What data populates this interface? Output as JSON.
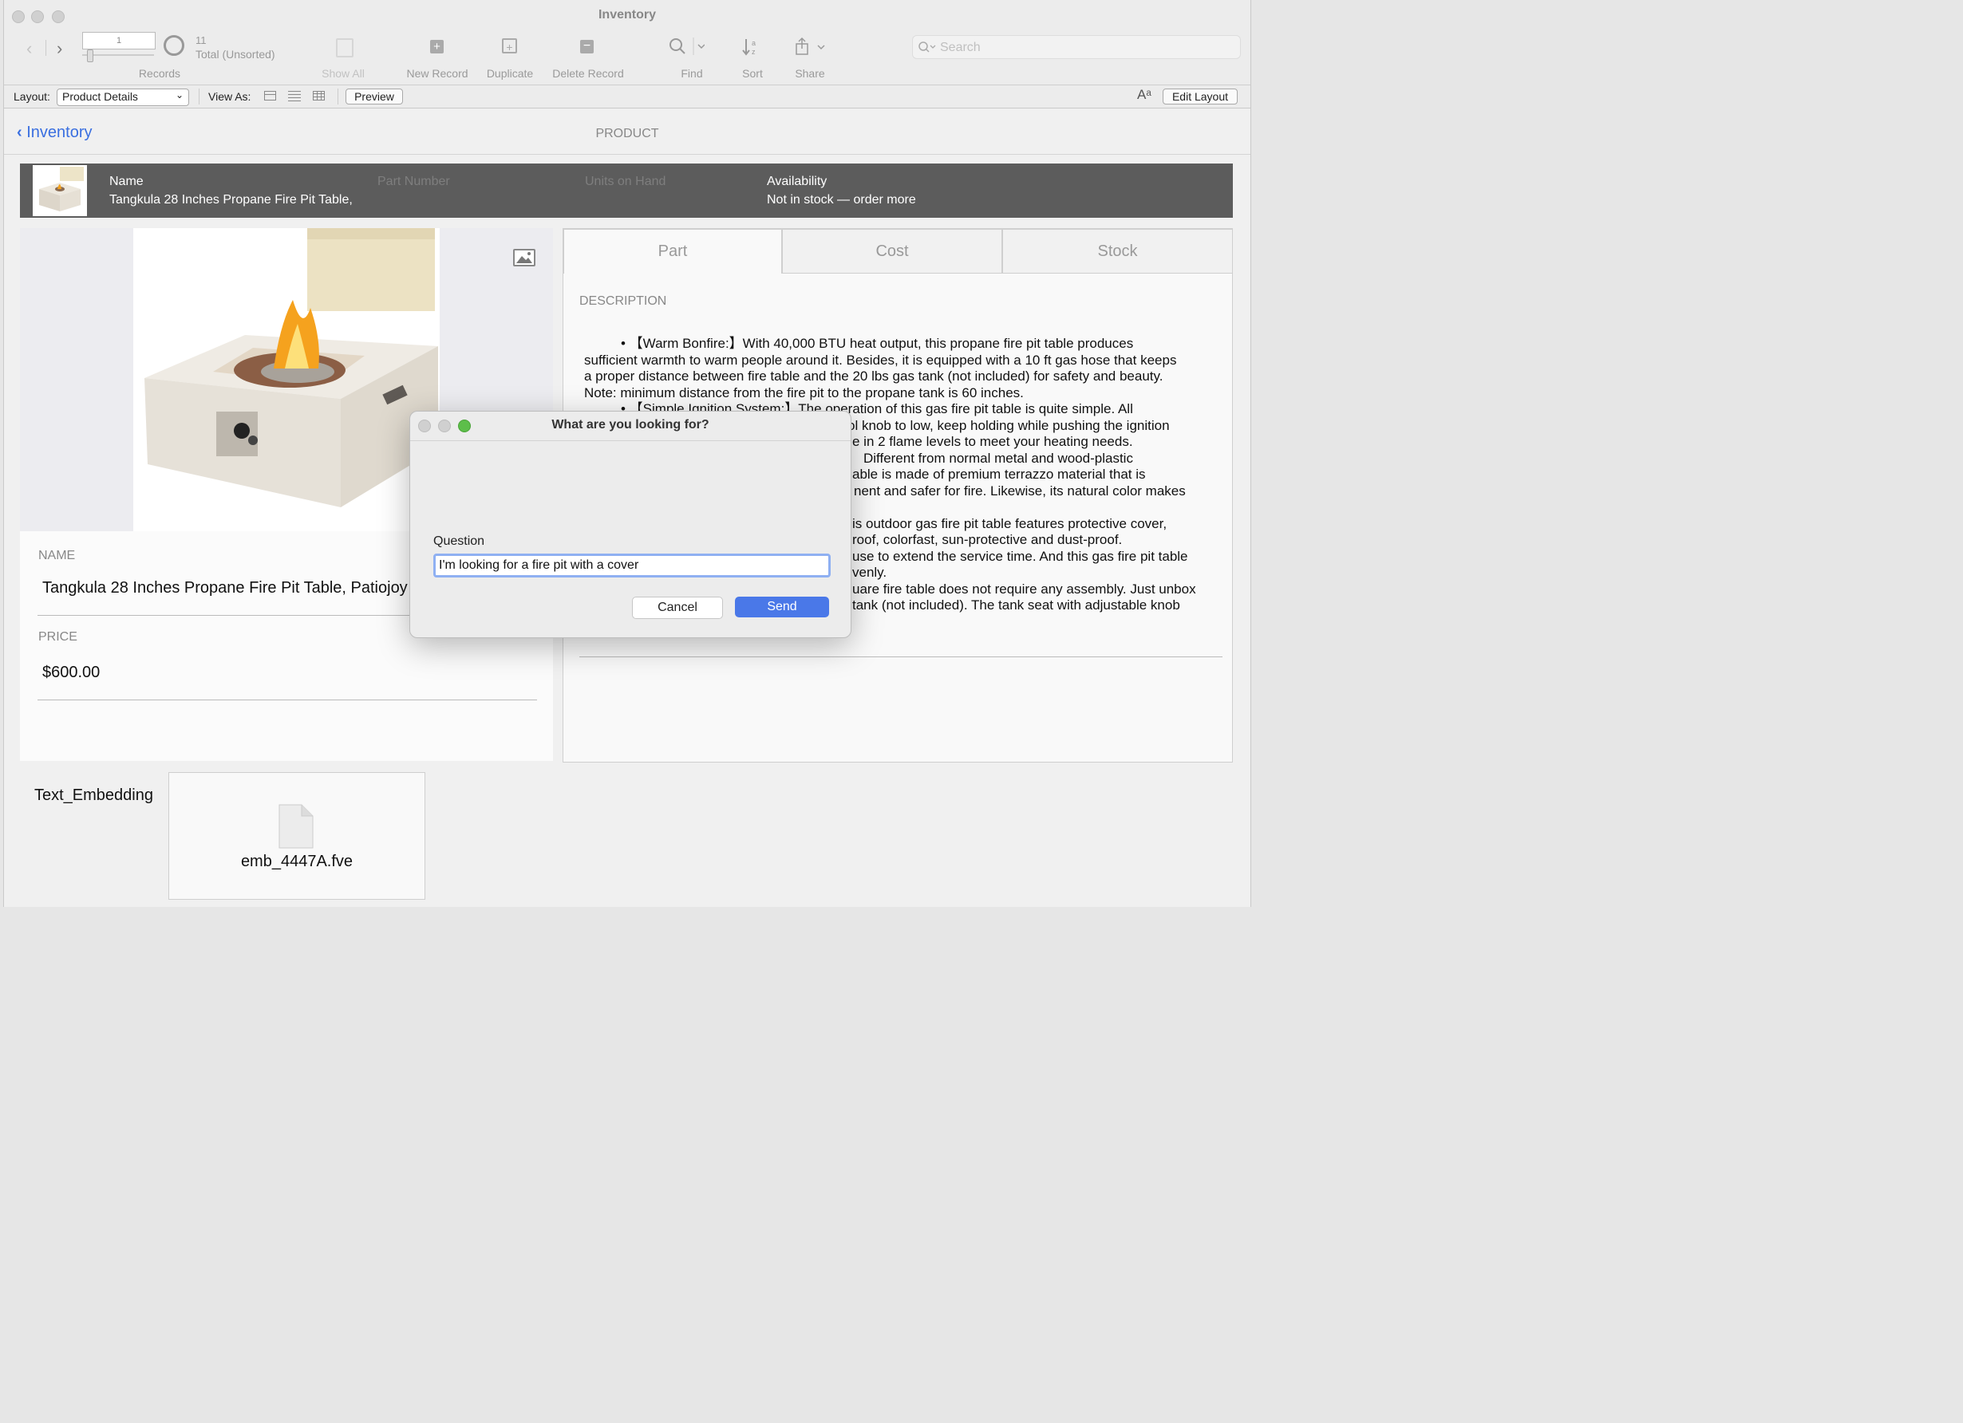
{
  "window": {
    "title": "Inventory"
  },
  "toolbar": {
    "record_number": "1",
    "total_count": "11",
    "total_label": "Total (Unsorted)",
    "records_label": "Records",
    "show_all": "Show All",
    "new_record": "New Record",
    "duplicate": "Duplicate",
    "delete_record": "Delete Record",
    "find": "Find",
    "sort": "Sort",
    "share": "Share",
    "search_placeholder": "Search"
  },
  "layoutbar": {
    "layout_label": "Layout:",
    "layout_value": "Product Details",
    "view_as_label": "View As:",
    "preview": "Preview",
    "edit_layout": "Edit Layout",
    "font_icon_text": "Aᵃ"
  },
  "nav": {
    "back_label": "Inventory",
    "section_title": "PRODUCT"
  },
  "header": {
    "name_label": "Name",
    "name_value": "Tangkula 28 Inches Propane Fire Pit Table,",
    "part_number_label": "Part Number",
    "units_label": "Units on Hand",
    "availability_label": "Availability",
    "availability_value": "Not in stock — order more"
  },
  "product": {
    "name_label": "NAME",
    "name_value": "Tangkula 28 Inches Propane Fire Pit Table, Patiojoy",
    "price_label": "PRICE",
    "price_value": "$600.00"
  },
  "tabs": [
    "Part",
    "Cost",
    "Stock"
  ],
  "description": {
    "label": "DESCRIPTION",
    "lines": [
      "•          【Warm Bonfire:】With 40,000 BTU heat output, this propane fire pit table produces",
      "sufficient warmth to warm people around it. Besides, it is equipped with a 10 ft gas hose that keeps",
      "a proper distance between fire table and the 20 lbs gas tank (not included) for safety and beauty.",
      "Note: minimum distance from the fire pit to the propane tank is 60 inches.",
      "•          【Simple Ignition System:】The operation of this gas fire pit table is quite simple. All",
      "ol knob to low, keep holding while pushing the ignition",
      "e in 2 flame levels to meet your heating needs.",
      "Different from normal metal and wood-plastic",
      "able is made of premium terrazzo material that is",
      "nent and safer for fire. Likewise, its natural color makes",
      "is outdoor gas fire pit table features protective cover,",
      "roof, colorfast, sun-protective and dust-proof.",
      "use to extend the service time. And this gas fire pit table",
      "venly.",
      "uare fire table does not require any assembly. Just unbox",
      "tank (not included). The tank seat with adjustable knob"
    ]
  },
  "embedding": {
    "label": "Text_Embedding",
    "file_name": "emb_4447A.fve"
  },
  "dialog": {
    "title": "What are you looking for?",
    "question_label": "Question",
    "question_value": "I'm looking for a fire pit with a cover",
    "cancel": "Cancel",
    "send": "Send"
  },
  "colors": {
    "accent": "#4a78e8",
    "link": "#3a6fe0",
    "header_band": "#5c5c5c",
    "green_light": "#5dbe4a"
  }
}
